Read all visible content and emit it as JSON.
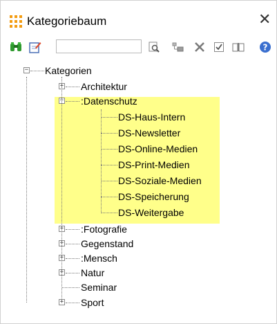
{
  "window": {
    "title": "Kategoriebaum",
    "close_symbol": "✕"
  },
  "toolbar": {
    "search_value": "",
    "search_placeholder": ""
  },
  "tree": {
    "root": "Kategorien",
    "items": [
      {
        "label": "Architektur",
        "expand": "+"
      },
      {
        "label": ":Datenschutz",
        "expand": "−"
      },
      {
        "label": ":Fotografie",
        "expand": "+"
      },
      {
        "label": "Gegenstand",
        "expand": "+"
      },
      {
        "label": ":Mensch",
        "expand": "+"
      },
      {
        "label": "Natur",
        "expand": "+"
      },
      {
        "label": "Seminar",
        "expand": ""
      },
      {
        "label": "Sport",
        "expand": "+"
      }
    ],
    "datenschutz_children": [
      "DS-Haus-Intern",
      "DS-Newsletter",
      "DS-Online-Medien",
      "DS-Print-Medien",
      "DS-Soziale-Medien",
      "DS-Speicherung",
      "DS-Weitergabe"
    ],
    "root_expand": "−"
  },
  "colors": {
    "highlight": "#ffff8a",
    "accent": "#f39c12"
  }
}
